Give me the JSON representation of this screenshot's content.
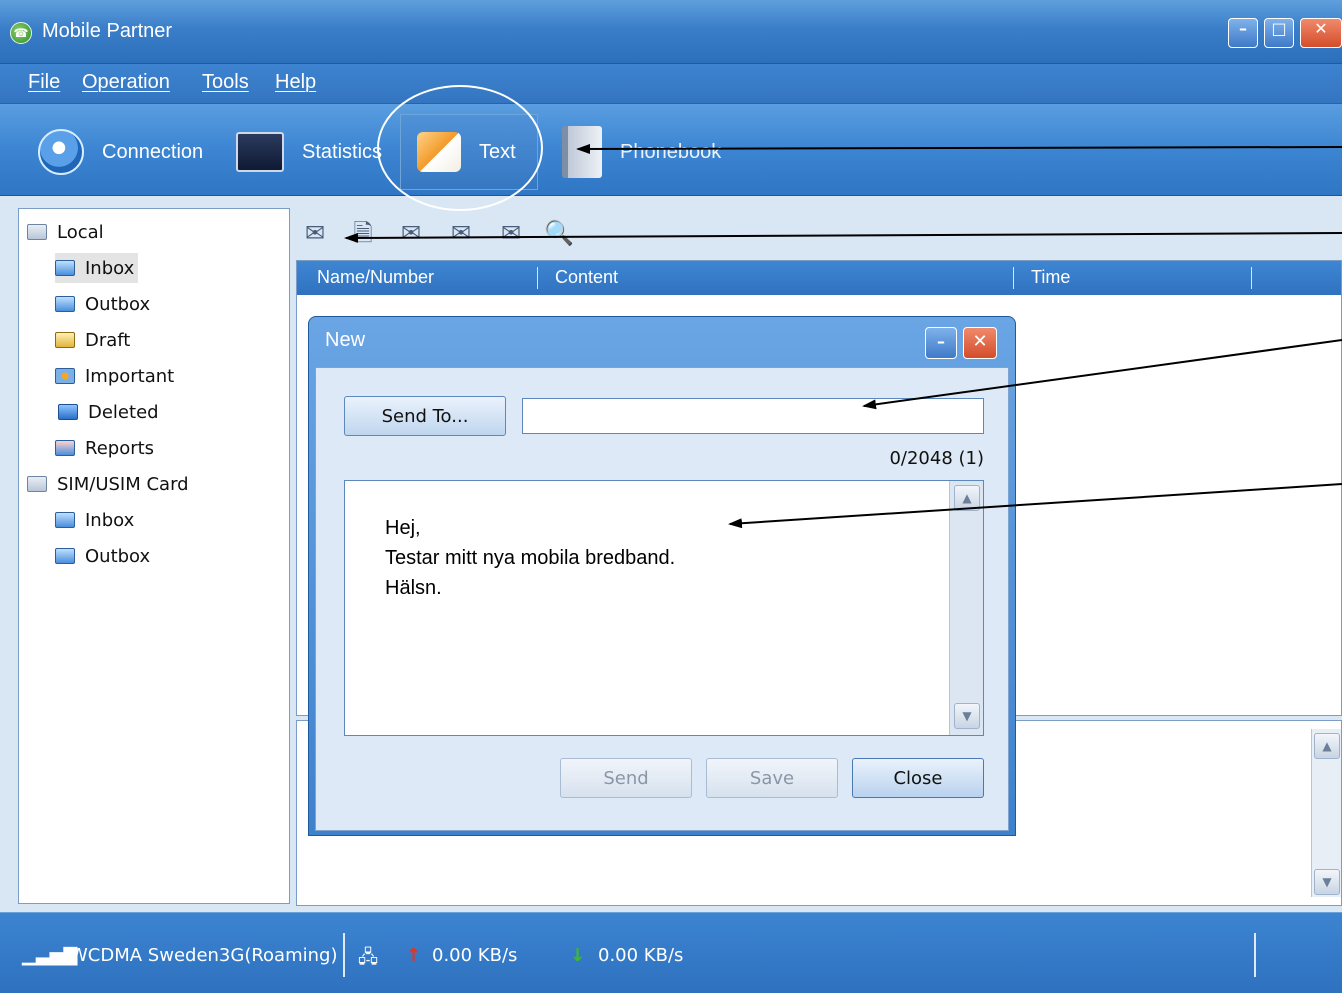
{
  "window": {
    "title": "Mobile Partner",
    "min_label": "–",
    "max_label": "□",
    "close_label": "✕"
  },
  "menu": [
    "File",
    "Operation",
    "Tools",
    "Help"
  ],
  "nav": {
    "connection": "Connection",
    "statistics": "Statistics",
    "text": "Text",
    "phonebook": "Phonebook"
  },
  "tree": {
    "local": "Local",
    "local_items": [
      "Inbox",
      "Outbox",
      "Draft",
      "Important",
      "Deleted",
      "Reports"
    ],
    "sim": "SIM/USIM Card",
    "sim_items": [
      "Inbox",
      "Outbox"
    ]
  },
  "toolbar_icons": [
    "new-message-icon",
    "delete-icon",
    "reply-icon",
    "forward-icon",
    "resend-icon",
    "search-icon"
  ],
  "list": {
    "columns": [
      "Name/Number",
      "Content",
      "Time"
    ]
  },
  "dialog": {
    "title": "New",
    "send_to": "Send To...",
    "recipient_value": "",
    "counter": "0/2048 (1)",
    "message": "Hej,\nTestar mitt nya mobila bredband.\nHälsn.",
    "send": "Send",
    "save": "Save",
    "close": "Close"
  },
  "status": {
    "network": "WCDMA Sweden3G(Roaming)",
    "upload": "0.00 KB/s",
    "download": "0.00 KB/s"
  },
  "colors": {
    "accent": "#3a7ec9",
    "arrow": "#000000"
  }
}
